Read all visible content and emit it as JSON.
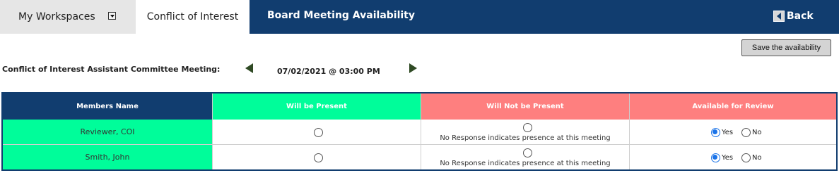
{
  "nav": {
    "workspaces_label": "My Workspaces",
    "coi_tab_label": "Conflict of Interest",
    "page_title": "Board Meeting Availability",
    "back_label": "Back"
  },
  "toolbar": {
    "save_label": "Save the availability"
  },
  "meeting": {
    "label": "Conflict of Interest Assistant Committee Meeting:",
    "datetime": "07/02/2021 @ 03:00 PM"
  },
  "table": {
    "headers": [
      "Members Name",
      "Will be Present",
      "Will Not be Present",
      "Available for Review"
    ],
    "rows": [
      {
        "name": "Reviewer, COI",
        "will_be_present": false,
        "will_not_be_present": false,
        "note": "No Response indicates presence at this meeting",
        "available_for_review": "Yes"
      },
      {
        "name": "Smith, John",
        "will_be_present": false,
        "will_not_be_present": false,
        "note": "No Response indicates presence at this meeting",
        "available_for_review": "Yes"
      }
    ],
    "review_options": {
      "yes": "Yes",
      "no": "No"
    }
  },
  "colors": {
    "nav_bg": "#113d6f",
    "present_header": "#00fd9a",
    "absent_header": "#fe7f7f",
    "radio_selected": "#1a73e8"
  },
  "icons": {
    "workspaces_dropdown": "chevron-down-icon",
    "back": "back-arrow-icon",
    "prev": "triangle-left-icon",
    "next": "triangle-right-icon"
  }
}
